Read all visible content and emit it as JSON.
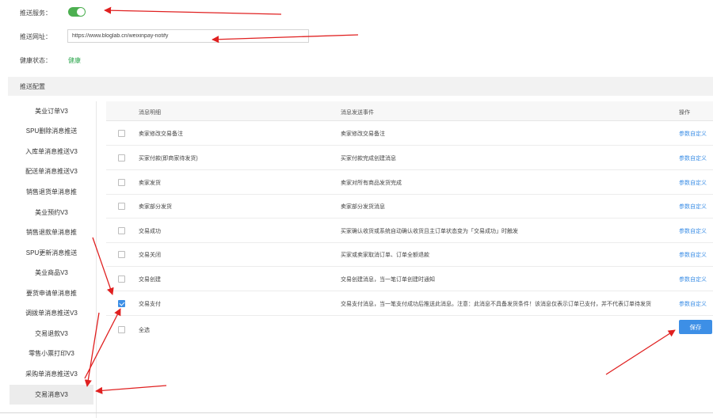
{
  "form": {
    "push_service_label": "推送服务：",
    "push_service_on": true,
    "push_url_label": "推送网址：",
    "push_url_value": "https://www.bloglab.cn/weixinpay-notify",
    "health_label": "健康状态：",
    "health_value": "健康"
  },
  "section": {
    "title": "推送配置"
  },
  "sidebar": {
    "items": [
      {
        "label": "美业订单V3"
      },
      {
        "label": "SPU删除消息推送"
      },
      {
        "label": "入库单消息推送V3"
      },
      {
        "label": "配送单消息推送V3"
      },
      {
        "label": "销售退货单消息推"
      },
      {
        "label": "美业预约V3"
      },
      {
        "label": "销售退款单消息推"
      },
      {
        "label": "SPU更新消息推送"
      },
      {
        "label": "美业商品V3"
      },
      {
        "label": "要货申请单消息推"
      },
      {
        "label": "调拨单消息推送V3"
      },
      {
        "label": "交易退款V3"
      },
      {
        "label": "零售小票打印V3"
      },
      {
        "label": "采购单消息推送V3"
      },
      {
        "label": "交易消息V3",
        "active": true
      }
    ]
  },
  "table": {
    "headers": {
      "name": "消息明细",
      "event": "消息发送事件",
      "op": "操作"
    },
    "rows": [
      {
        "name": "卖家修改交易备注",
        "event": "卖家修改交易备注",
        "op": "参数自定义",
        "checked": false
      },
      {
        "name": "买家付款(即商家待发货)",
        "event": "买家付款完成创建消息",
        "op": "参数自定义",
        "checked": false
      },
      {
        "name": "卖家发货",
        "event": "卖家对所有商品发货完成",
        "op": "参数自定义",
        "checked": false
      },
      {
        "name": "卖家部分发货",
        "event": "卖家部分发货消息",
        "op": "参数自定义",
        "checked": false
      },
      {
        "name": "交易成功",
        "event": "买家确认收货或系统自动确认收货且主订单状态变为「交易成功」时触发",
        "op": "参数自定义",
        "checked": false
      },
      {
        "name": "交易关闭",
        "event": "买家或卖家取消订单、订单全额退款",
        "op": "参数自定义",
        "checked": false
      },
      {
        "name": "交易创建",
        "event": "交易创建消息，当一笔订单创建时通知",
        "op": "参数自定义",
        "checked": false
      },
      {
        "name": "交易支付",
        "event": "交易支付消息，当一笔支付成功后推送此消息。注意：此消息不具备发货条件！该消息仅表示订单已支付，并不代表订单待发货",
        "op": "参数自定义",
        "checked": true
      }
    ],
    "select_all_label": "全选",
    "save_label": "保存"
  },
  "colors": {
    "accent": "#3d8fe6",
    "toggle_on": "#4caf50",
    "health": "#32a852",
    "annotation": "#e02020"
  }
}
